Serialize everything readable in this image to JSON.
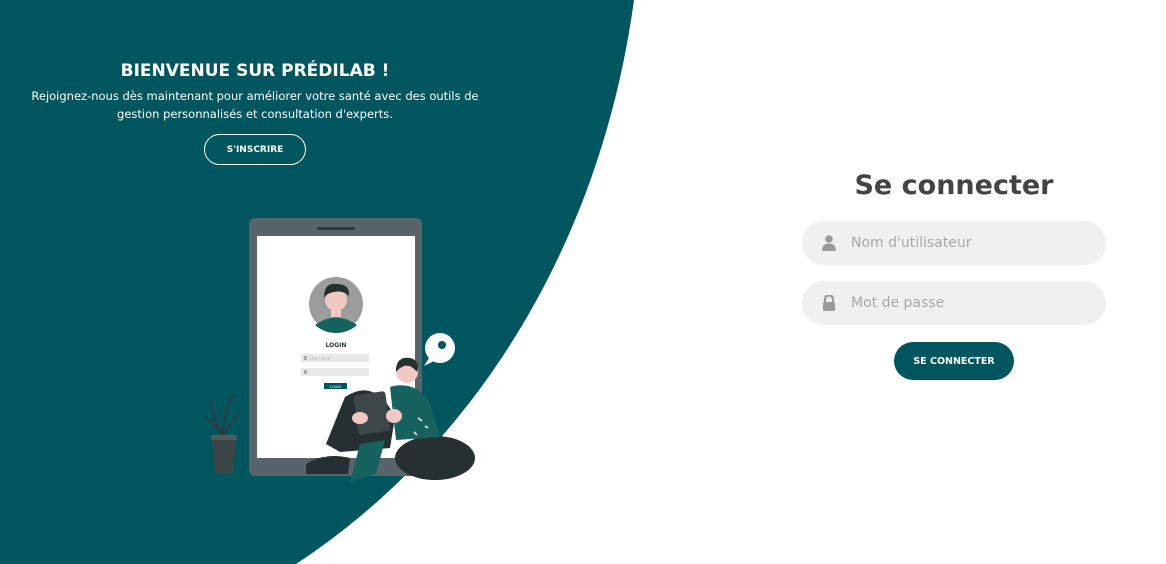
{
  "colors": {
    "brand": "#00565f",
    "field_bg": "#f0f0f0",
    "title_text": "#444444"
  },
  "welcome": {
    "title": "BIENVENUE SUR PRÉDILAB !",
    "text": "Rejoignez-nous dès maintenant pour améliorer votre santé avec des outils de gestion personnalisés et consultation d'experts.",
    "signup_label": "S'INSCRIRE"
  },
  "illustration": {
    "screen_heading": "LOGIN",
    "username_hint": "Username",
    "button_label": "LOGIN"
  },
  "login": {
    "title": "Se connecter",
    "username": {
      "placeholder": "Nom d'utilisateur",
      "value": "",
      "icon": "user-icon"
    },
    "password": {
      "placeholder": "Mot de passe",
      "value": "",
      "icon": "lock-icon"
    },
    "submit_label": "SE CONNECTER"
  }
}
